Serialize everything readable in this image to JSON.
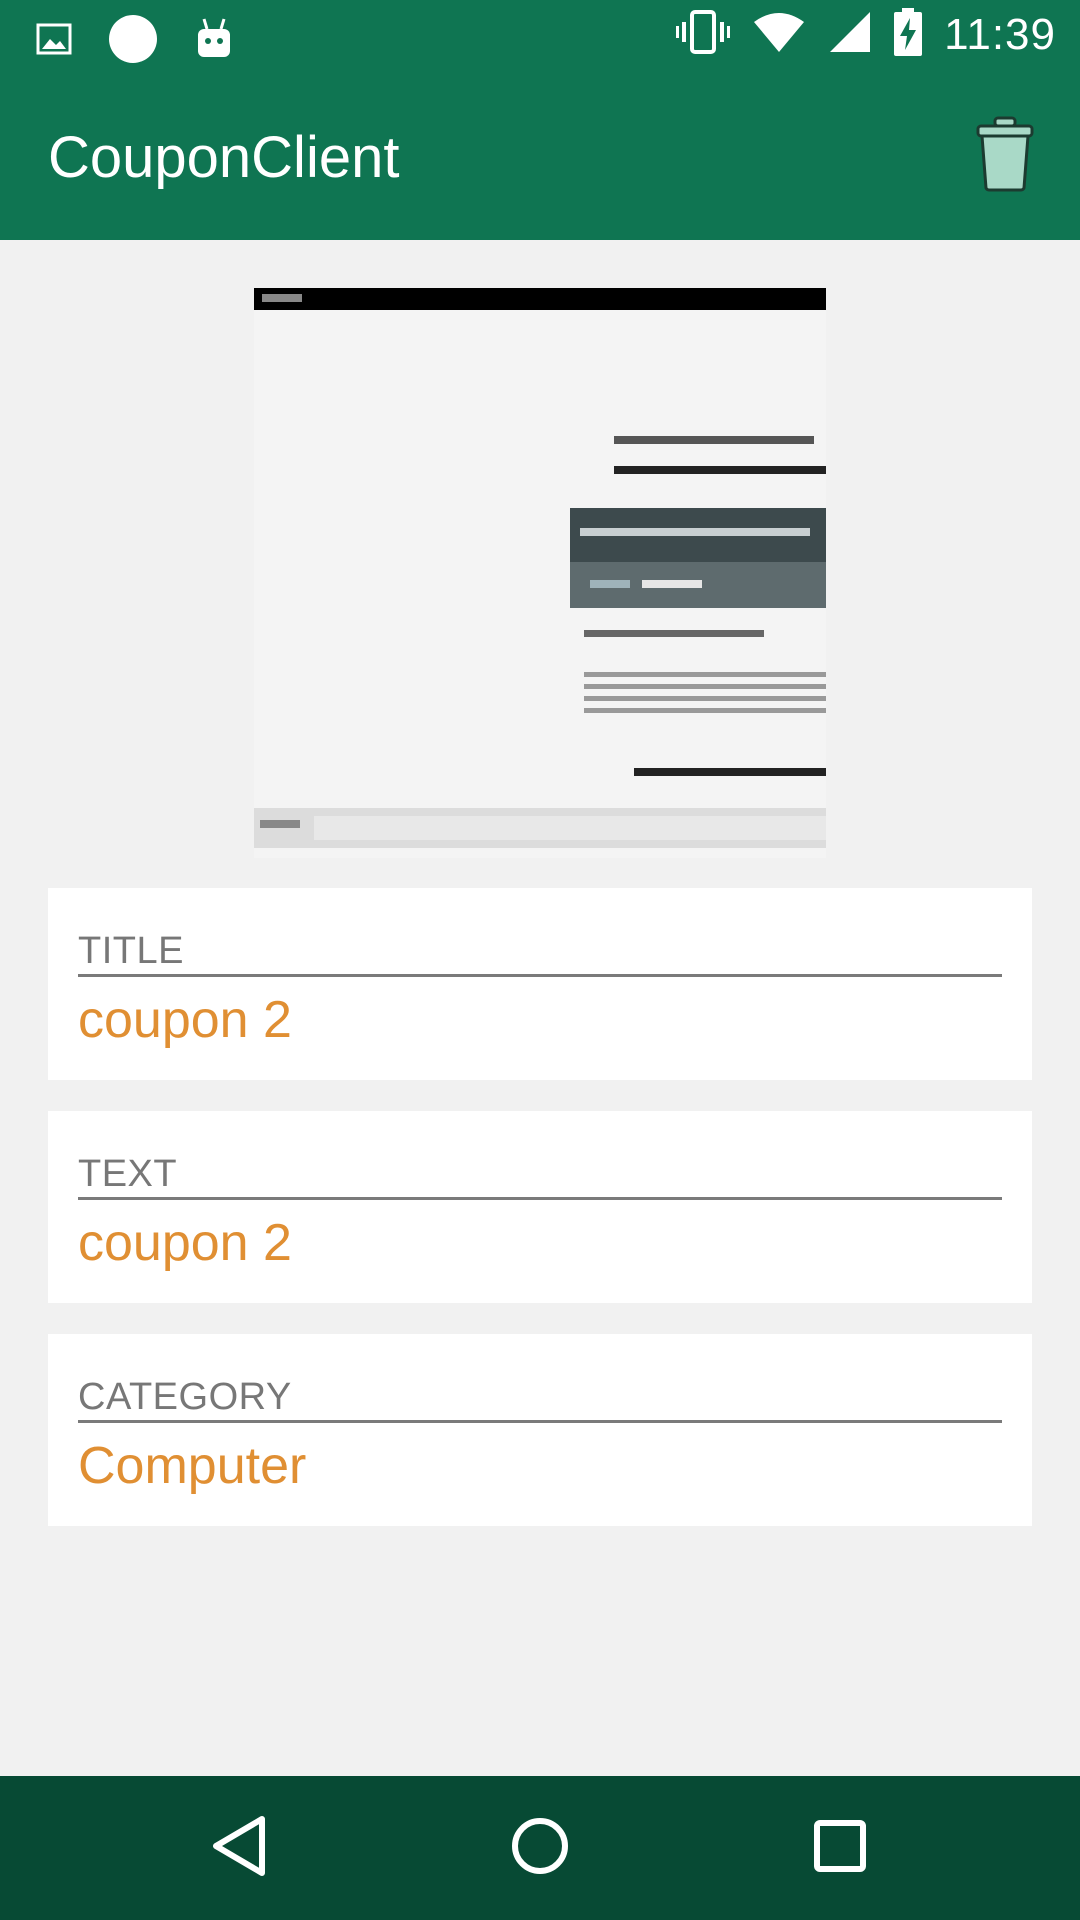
{
  "status_bar": {
    "time": "11:39",
    "icons": [
      "image-icon",
      "circle-icon",
      "android-icon",
      "vibrate-icon",
      "wifi-icon",
      "signal-icon",
      "battery-charging-icon"
    ]
  },
  "app_bar": {
    "title": "CouponClient",
    "action_icon": "trash-icon"
  },
  "coupon_image": {
    "alt": "coupon screenshot thumbnail"
  },
  "fields": [
    {
      "label": "TITLE",
      "value": "coupon 2"
    },
    {
      "label": "TEXT",
      "value": "coupon 2"
    },
    {
      "label": "CATEGORY",
      "value": "Computer"
    }
  ],
  "nav_bar": {
    "buttons": [
      "back-icon",
      "home-icon",
      "recents-icon"
    ]
  },
  "colors": {
    "primary": "#0f7552",
    "primary_dark": "#074a34",
    "accent": "#e08f33",
    "background": "#f1f1f1"
  }
}
